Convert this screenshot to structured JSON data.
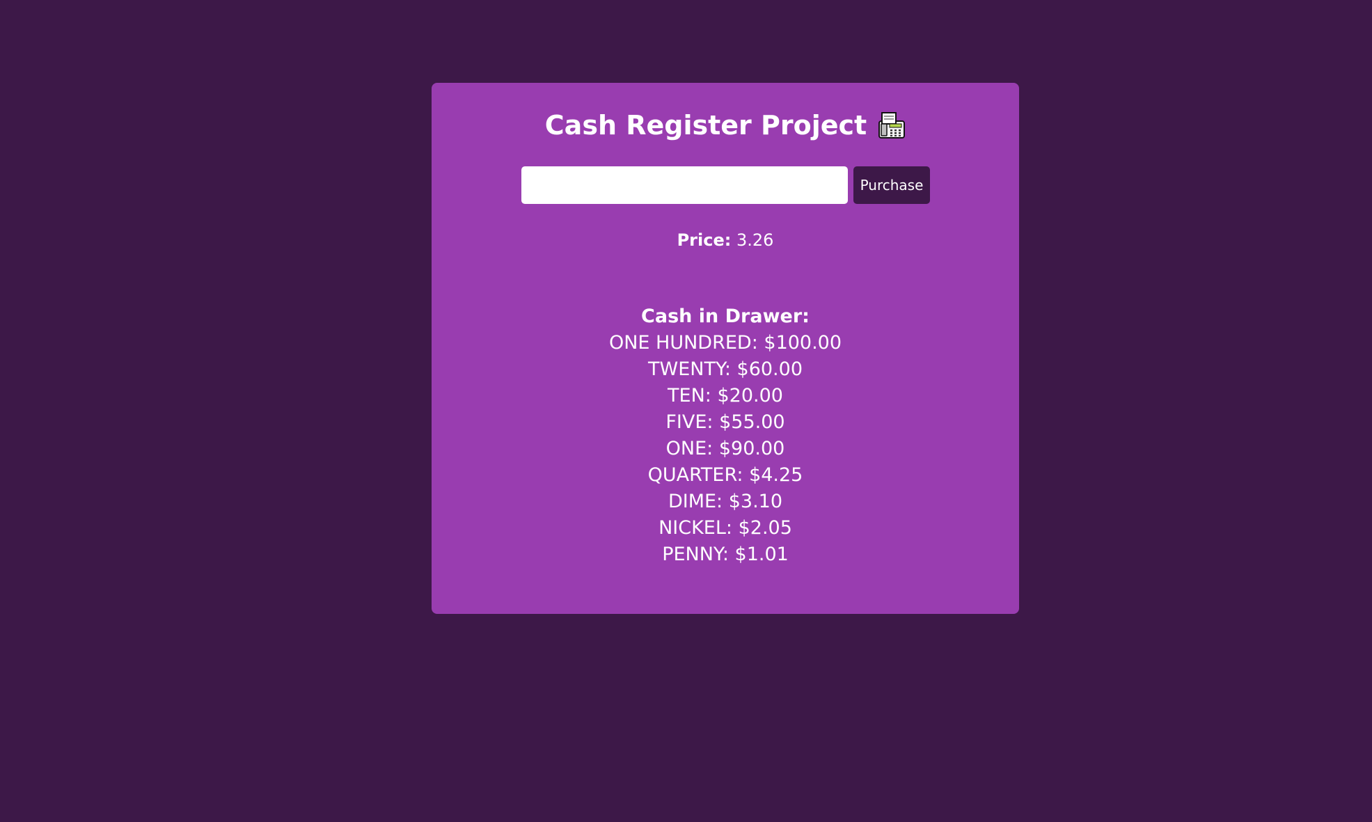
{
  "app": {
    "title": "Cash Register Project"
  },
  "colors": {
    "background": "#3d1848",
    "card": "#993db0",
    "button": "#3d1848",
    "text": "#ffffff"
  },
  "icons": {
    "title_icon": "fax-machine-icon"
  },
  "form": {
    "cash_input_value": "",
    "cash_input_placeholder": "",
    "purchase_label": "Purchase"
  },
  "price": {
    "label": "Price:",
    "value": "3.26"
  },
  "drawer": {
    "heading": "Cash in Drawer:",
    "items": [
      "ONE HUNDRED: $100.00",
      "TWENTY: $60.00",
      "TEN: $20.00",
      "FIVE: $55.00",
      "ONE: $90.00",
      "QUARTER: $4.25",
      "DIME: $3.10",
      "NICKEL: $2.05",
      "PENNY: $1.01"
    ]
  }
}
